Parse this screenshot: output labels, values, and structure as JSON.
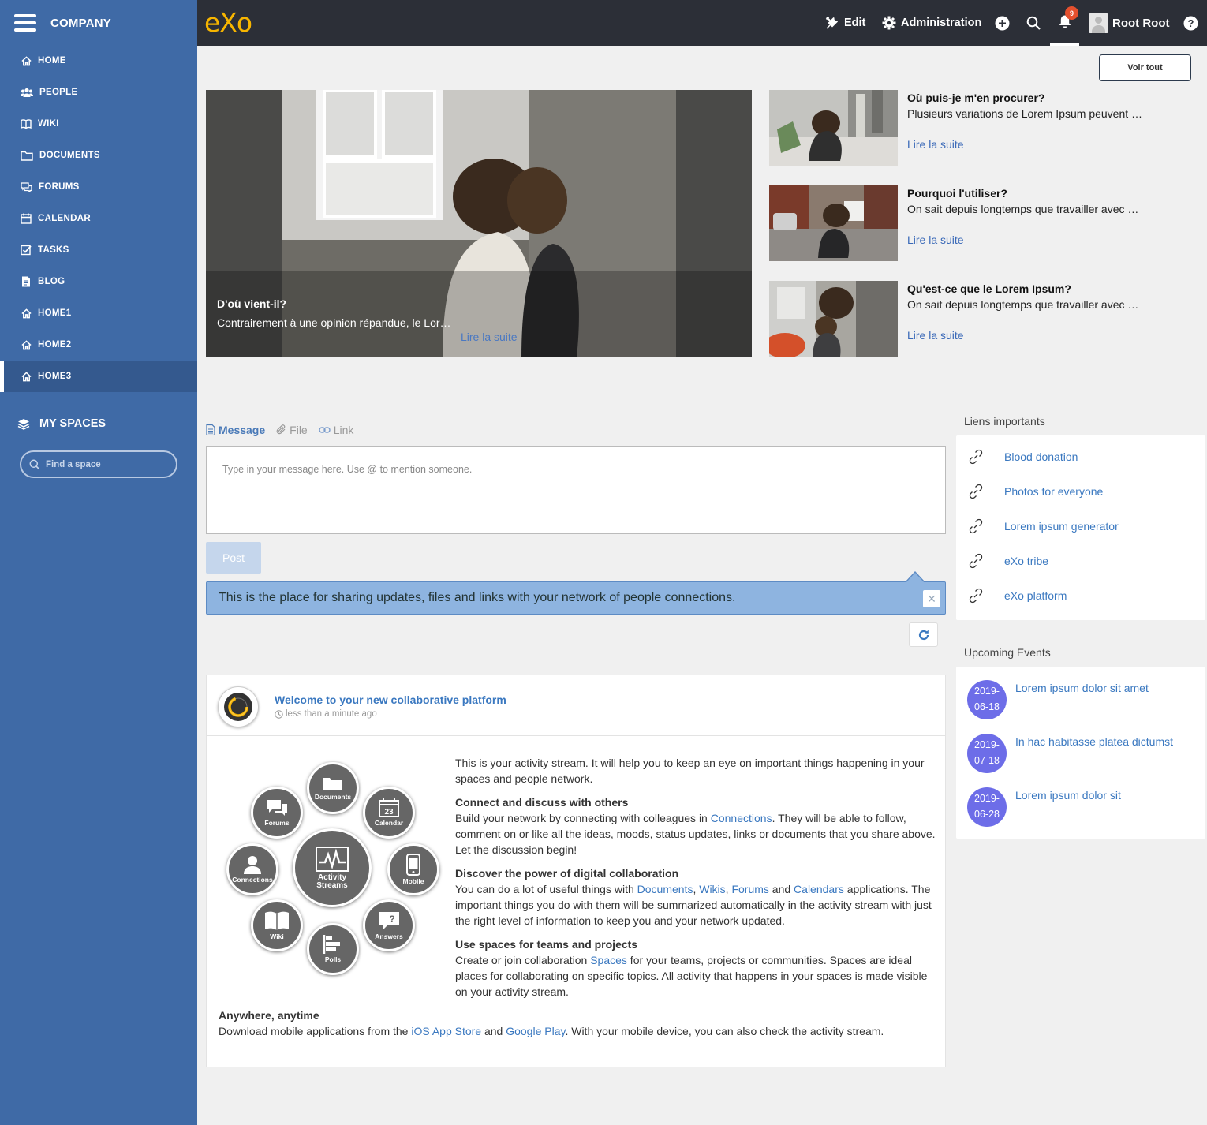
{
  "sidebar": {
    "company": "COMPANY",
    "items": [
      {
        "label": "HOME"
      },
      {
        "label": "PEOPLE"
      },
      {
        "label": "WIKI"
      },
      {
        "label": "DOCUMENTS"
      },
      {
        "label": "FORUMS"
      },
      {
        "label": "CALENDAR"
      },
      {
        "label": "TASKS"
      },
      {
        "label": "BLOG"
      },
      {
        "label": "HOME1"
      },
      {
        "label": "HOME2"
      },
      {
        "label": "HOME3"
      }
    ],
    "my_spaces": "MY SPACES",
    "find_space_placeholder": "Find a space"
  },
  "topbar": {
    "logo": "eXo",
    "edit": "Edit",
    "administration": "Administration",
    "notifications_count": "9",
    "user_name": "Root Root"
  },
  "news": {
    "see_all": "Voir tout",
    "featured": {
      "title": "D'où vient-il?",
      "summary": "Contrairement à une opinion répandue, le Lor…",
      "link": "Lire la suite"
    },
    "items": [
      {
        "title": "Où puis-je m'en procurer?",
        "summary": "Plusieurs variations de Lorem Ipsum peuvent …",
        "link": "Lire la suite"
      },
      {
        "title": "Pourquoi l'utiliser?",
        "summary": "On sait depuis longtemps que travailler avec …",
        "link": "Lire la suite"
      },
      {
        "title": "Qu'est-ce que le Lorem Ipsum?",
        "summary": "On sait depuis longtemps que travailler avec …",
        "link": "Lire la suite"
      }
    ]
  },
  "composer": {
    "tabs": [
      "Message",
      "File",
      "Link"
    ],
    "placeholder": "Type in your message here. Use @ to mention someone.",
    "post": "Post",
    "info": "This is the place for sharing updates, files and links with your network of people connections.",
    "close": "×"
  },
  "activity": {
    "title": "Welcome to your new collaborative platform",
    "time": "less than a minute ago",
    "bubbles": {
      "documents": "Documents",
      "forums": "Forums",
      "calendar": "Calendar",
      "calendar_day": "23",
      "connections": "Connections",
      "activity_streams_1": "Activity",
      "activity_streams_2": "Streams",
      "mobile": "Mobile",
      "wiki": "Wiki",
      "polls": "Polls",
      "answers": "Answers"
    },
    "intro": "This is your activity stream. It will help you to keep an eye on important things happening in your spaces and people network.",
    "s1_title": "Connect and discuss with others",
    "s1_a": "Build your network by connecting with colleagues in ",
    "s1_link": "Connections",
    "s1_b": ". They will be able to follow, comment on or like all the ideas, moods, status updates, links or documents that you share above. Let the discussion begin!",
    "s2_title": "Discover the power of digital collaboration",
    "s2_a": "You can do a lot of useful things with ",
    "s2_l1": "Documents",
    "s2_c1": ", ",
    "s2_l2": "Wikis",
    "s2_c2": ", ",
    "s2_l3": "Forums",
    "s2_and": " and ",
    "s2_l4": "Calendars",
    "s2_b": " applications. The important things you do with them will be summarized automatically in the activity stream with just the right level of information to keep you and your network updated.",
    "s3_title": "Use spaces for teams and projects",
    "s3_a": "Create or join collaboration ",
    "s3_link": "Spaces",
    "s3_b": " for your teams, projects or communities. Spaces are ideal places for collaborating on specific topics. All activity that happens in your spaces is made visible on your activity stream.",
    "s4_title": "Anywhere, anytime",
    "s4_a": "Download mobile applications from the ",
    "s4_l1": "iOS App Store",
    "s4_and": " and ",
    "s4_l2": "Google Play",
    "s4_b": ". With your mobile device, you can also check the activity stream."
  },
  "links_widget": {
    "title": "Liens importants",
    "items": [
      "Blood donation",
      "Photos for everyone",
      "Lorem ipsum generator",
      "eXo tribe",
      "eXo platform"
    ]
  },
  "events_widget": {
    "title": "Upcoming Events",
    "items": [
      {
        "date_line1": "2019-",
        "date_line2": "06-18",
        "title": "Lorem ipsum dolor sit amet"
      },
      {
        "date_line1": "2019-",
        "date_line2": "07-18",
        "title": "In hac habitasse platea dictumst"
      },
      {
        "date_line1": "2019-",
        "date_line2": "06-28",
        "title": "Lorem ipsum dolor sit"
      }
    ]
  },
  "colors": {
    "sidebar": "#3f6aa6",
    "topbar": "#2c2f37",
    "accent_link": "#3a78c0",
    "logo": "#f7b500",
    "badge": "#e4502e",
    "event_date": "#6d6de8"
  },
  "icons": [
    "hamburger-icon",
    "home-icon",
    "people-icon",
    "book-icon",
    "folder-icon",
    "forums-icon",
    "calendar-icon",
    "tasks-icon",
    "blog-icon",
    "layers-icon",
    "search-icon",
    "wrench-icon",
    "gear-icon",
    "plus-circle-icon",
    "bell-icon",
    "help-icon",
    "link-icon",
    "refresh-icon",
    "clock-icon",
    "paperclip-icon"
  ]
}
